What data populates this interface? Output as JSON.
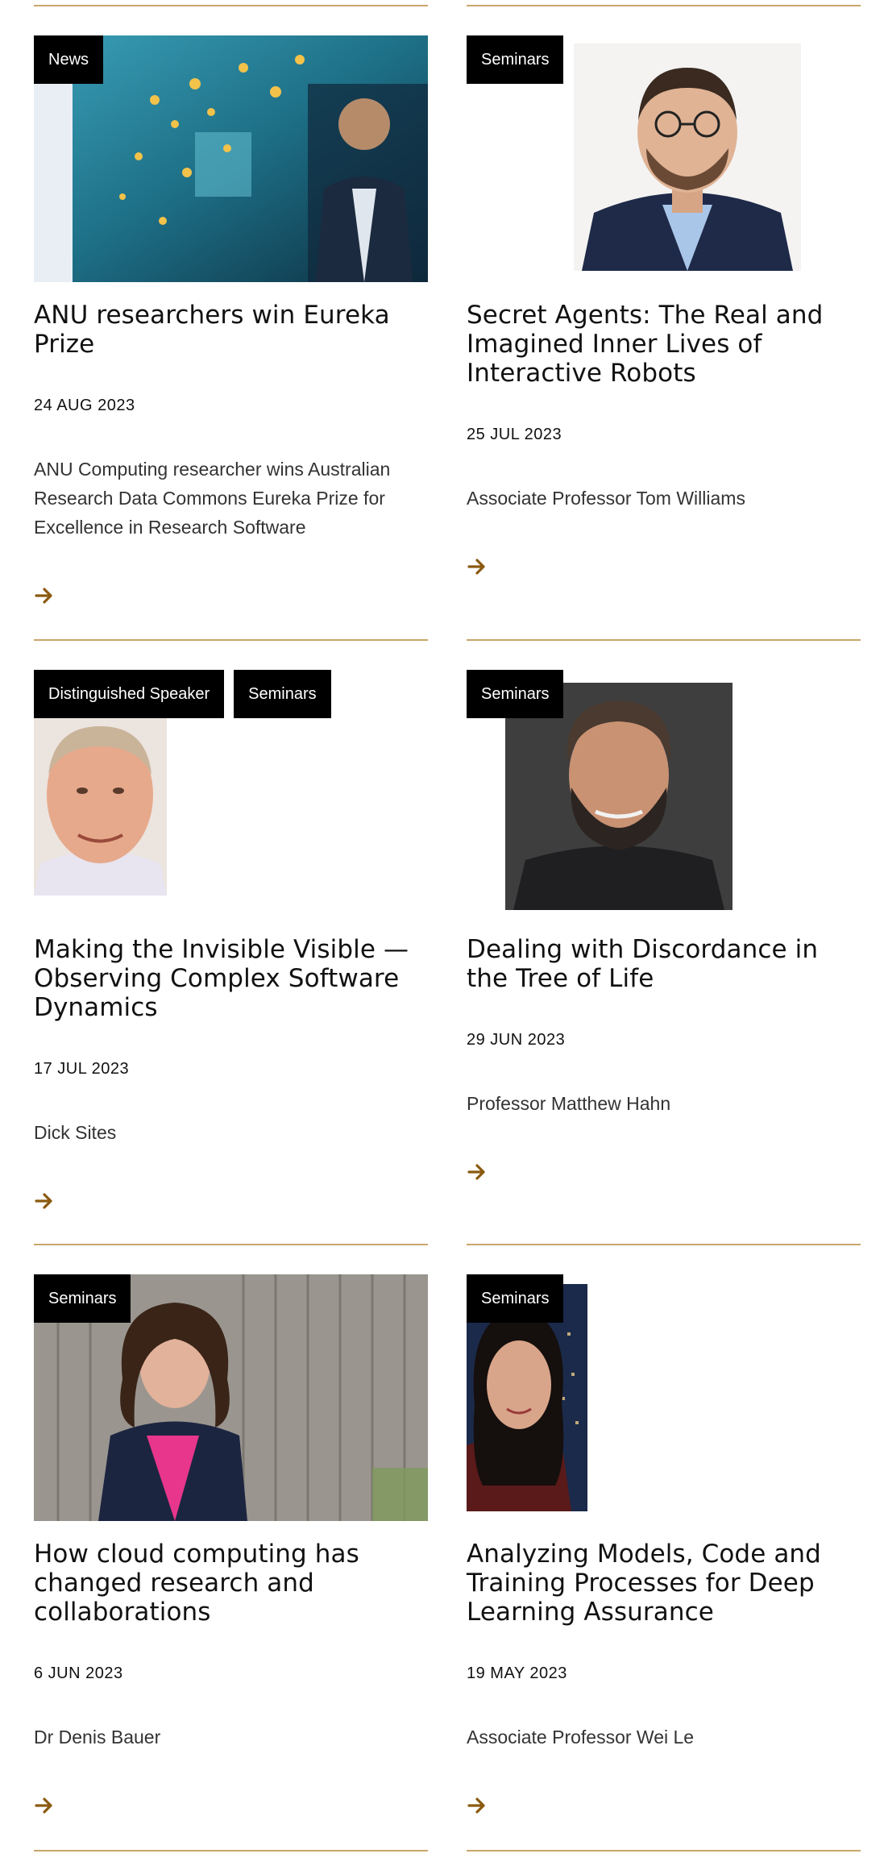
{
  "accent_color": "#c9a66b",
  "arrow_color": "#8a5a10",
  "badge_color": "#000000",
  "cards": [
    {
      "tags": [
        "News"
      ],
      "image": "researcher-with-butterfly-display-photo",
      "title": "ANU researchers win Eureka Prize",
      "date": "24 AUG 2023",
      "description": "ANU Computing researcher wins Australian Research Data Commons Eureka Prize for Excellence in Research Software",
      "link_icon": "arrow-right-icon"
    },
    {
      "tags": [
        "Seminars"
      ],
      "image": "speaker-portrait-glasses",
      "title": "Secret Agents: The Real and Imagined Inner Lives of Interactive Robots",
      "date": "25 JUL 2023",
      "description": "Associate Professor Tom Williams",
      "link_icon": "arrow-right-icon"
    },
    {
      "tags": [
        "Distinguished Speaker",
        "Seminars"
      ],
      "image": "speaker-portrait-older-man",
      "title": "Making the Invisible Visible — Observing Complex Software Dynamics",
      "date": "17 JUL 2023",
      "description": "Dick Sites",
      "link_icon": "arrow-right-icon"
    },
    {
      "tags": [
        "Seminars"
      ],
      "image": "speaker-portrait-bearded-man",
      "title": "Dealing with Discordance in the Tree of Life",
      "date": "29 JUN 2023",
      "description": "Professor Matthew Hahn",
      "link_icon": "arrow-right-icon"
    },
    {
      "tags": [
        "Seminars"
      ],
      "image": "speaker-portrait-woman-fence",
      "title": "How cloud computing has changed research and collaborations",
      "date": "6 JUN 2023",
      "description": "Dr Denis Bauer",
      "link_icon": "arrow-right-icon"
    },
    {
      "tags": [
        "Seminars"
      ],
      "image": "speaker-portrait-woman-city",
      "title": "Analyzing Models, Code and Training Processes for Deep Learning Assurance",
      "date": "19 MAY 2023",
      "description": "Associate Professor Wei Le",
      "link_icon": "arrow-right-icon"
    }
  ]
}
